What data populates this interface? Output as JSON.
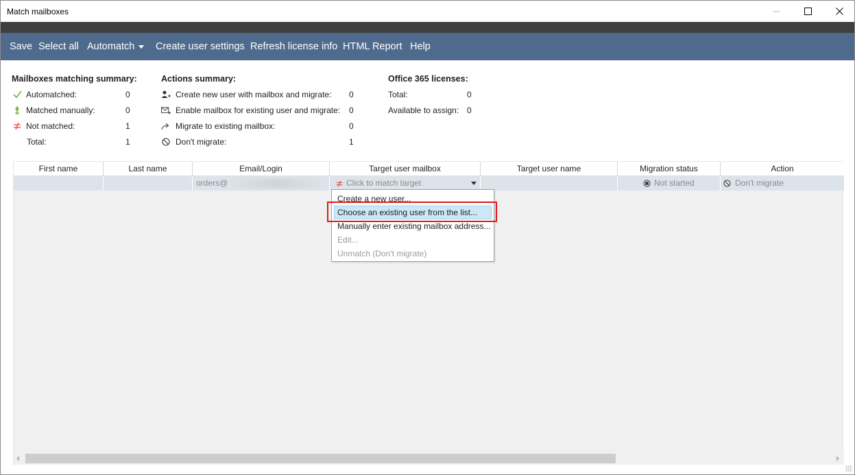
{
  "window": {
    "title": "Match mailboxes"
  },
  "menu": {
    "save": "Save",
    "select_all": "Select all",
    "automatch": "Automatch",
    "create_user_settings": "Create user settings",
    "refresh_license": "Refresh license info",
    "html_report": "HTML Report",
    "help": "Help"
  },
  "mailbox_summary": {
    "heading": "Mailboxes matching summary:",
    "rows": [
      {
        "label": "Automatched:",
        "value": "0",
        "icon": "check-icon"
      },
      {
        "label": "Matched manually:",
        "value": "0",
        "icon": "hand-icon"
      },
      {
        "label": "Not matched:",
        "value": "1",
        "icon": "not-equal-icon"
      },
      {
        "label": "Total:",
        "value": "1",
        "icon": ""
      }
    ]
  },
  "actions_summary": {
    "heading": "Actions summary:",
    "rows": [
      {
        "label": "Create new user with mailbox and migrate:",
        "value": "0",
        "icon": "add-user-icon"
      },
      {
        "label": "Enable mailbox for existing user and migrate:",
        "value": "0",
        "icon": "mail-enable-icon"
      },
      {
        "label": "Migrate to existing mailbox:",
        "value": "0",
        "icon": "migrate-arrow-icon"
      },
      {
        "label": "Don't migrate:",
        "value": "1",
        "icon": "no-entry-icon"
      }
    ]
  },
  "licenses": {
    "heading": "Office 365 licenses:",
    "rows": [
      {
        "label": "Total:",
        "value": "0"
      },
      {
        "label": "Available to assign:",
        "value": "0"
      }
    ]
  },
  "grid": {
    "columns": [
      "First name",
      "Last name",
      "Email/Login",
      "Target user mailbox",
      "Target user name",
      "Migration status",
      "Action"
    ],
    "row": {
      "first_name": "",
      "last_name": "",
      "email": "orders@",
      "target_mailbox": "Click to match target",
      "target_name": "",
      "status": "Not started",
      "action": "Don't migrate"
    }
  },
  "dropdown": {
    "items": [
      {
        "label": "Create a new user...",
        "enabled": true
      },
      {
        "label": "Choose an existing user from the list...",
        "enabled": true
      },
      {
        "label": "Manually enter existing mailbox address...",
        "enabled": true
      },
      {
        "label": "Edit...",
        "enabled": false
      },
      {
        "label": "Unmatch (Don't migrate)",
        "enabled": false
      }
    ]
  },
  "colors": {
    "menubar": "#4e6b8e",
    "titlebar_dark": "#404040",
    "row_selected": "#dde3eb",
    "highlight": "#e4121b",
    "hover": "#cce8f7"
  }
}
